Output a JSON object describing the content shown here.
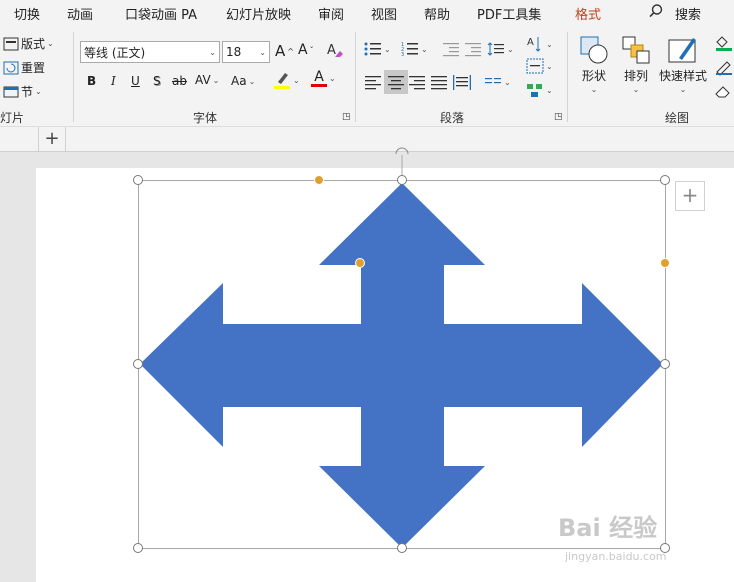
{
  "tabs": [
    "切换",
    "动画",
    "口袋动画 PA",
    "幻灯片放映",
    "审阅",
    "视图",
    "帮助",
    "PDF工具集",
    "格式"
  ],
  "active_tab": "格式",
  "search_label": "搜索",
  "slides_group": {
    "layout": "版式",
    "reset": "重置",
    "section": "节",
    "label": "灯片"
  },
  "font_group": {
    "font_name": "等线 (正文)",
    "font_size": "18",
    "grow": "A",
    "shrink": "A",
    "bold": "B",
    "italic": "I",
    "underline": "U",
    "shadow": "S",
    "strike": "ab",
    "spacing": "AV",
    "case": "Aa",
    "font_color": "A",
    "label": "字体"
  },
  "paragraph_group": {
    "label": "段落"
  },
  "drawing_group": {
    "shapes": "形状",
    "arrange": "排列",
    "quick_styles": "快速样式",
    "label": "绘图"
  },
  "colors": {
    "arrow_fill": "#4472c4",
    "accent_tab": "#c43e1c",
    "highlight": "#ffff00",
    "font_color": "#e00000"
  },
  "watermark": {
    "brand": "Bai  经验",
    "url": "jingyan.baidu.com"
  }
}
